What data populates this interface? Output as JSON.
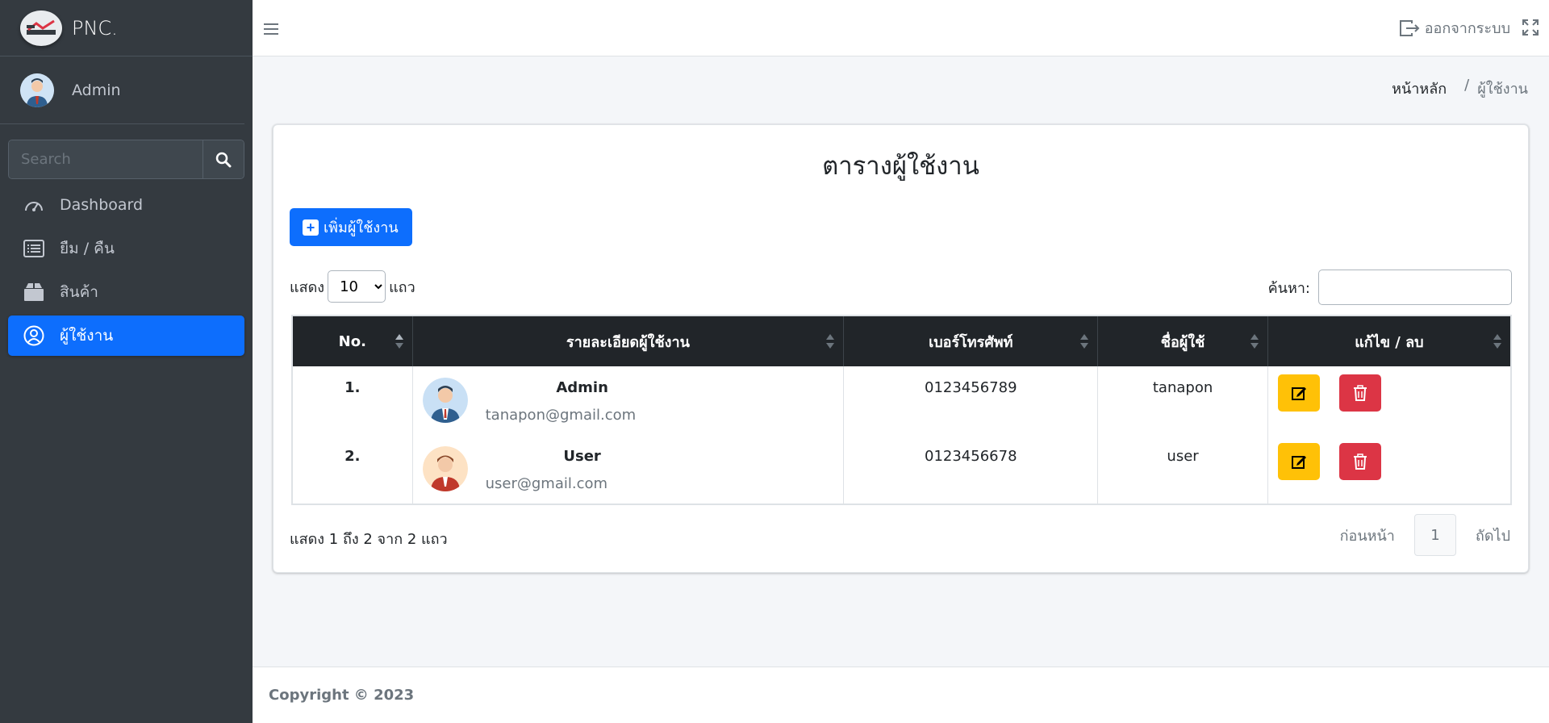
{
  "brand": {
    "name": "PNC."
  },
  "user": {
    "name": "Admin"
  },
  "sidebar": {
    "search_placeholder": "Search",
    "items": [
      {
        "label": "Dashboard",
        "icon": "dashboard-icon"
      },
      {
        "label": "ยืม / คืน",
        "icon": "list-icon"
      },
      {
        "label": "สินค้า",
        "icon": "box-icon"
      },
      {
        "label": "ผู้ใช้งาน",
        "icon": "user-circle-icon",
        "active": true
      }
    ]
  },
  "topbar": {
    "logout_label": "ออกจากระบบ"
  },
  "breadcrumb": {
    "home": "หน้าหลัก",
    "separator": "/",
    "current": "ผู้ใช้งาน"
  },
  "card": {
    "title": "ตารางผู้ใช้งาน",
    "add_button": "เพิ่มผู้ใช้งาน",
    "length": {
      "prefix": "แสดง",
      "selected": "10",
      "suffix": "แถว"
    },
    "search_label": "ค้นหา:"
  },
  "table": {
    "headers": [
      "No.",
      "รายละเอียดผู้ใช้งาน",
      "เบอร์โทรศัพท์",
      "ชื่อผู้ใช้",
      "แก้ไข / ลบ"
    ],
    "rows": [
      {
        "no": "1.",
        "name": "Admin",
        "email": "tanapon@gmail.com",
        "phone": "0123456789",
        "username": "tanapon"
      },
      {
        "no": "2.",
        "name": "User",
        "email": "user@gmail.com",
        "phone": "0123456678",
        "username": "user"
      }
    ]
  },
  "pagination": {
    "info": "แสดง 1 ถึง 2 จาก 2 แถว",
    "prev": "ก่อนหน้า",
    "page": "1",
    "next": "ถัดไป"
  },
  "footer": {
    "text": "Copyright © 2023"
  },
  "colors": {
    "sidebar": "#343a40",
    "primary": "#0d6efd",
    "warning": "#ffc107",
    "danger": "#dc3545",
    "table_header": "#212529"
  }
}
